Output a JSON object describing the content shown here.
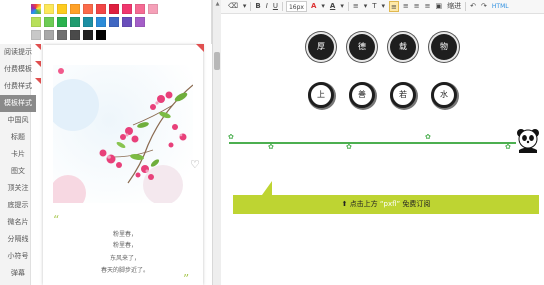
{
  "palette": {
    "rows": [
      [
        "#fde85a",
        "#fecb1f",
        "#ffa127",
        "#fb6b4a",
        "#f24646",
        "#de1f3f",
        "#f0376e",
        "#f56a93",
        "#f5a0b8"
      ],
      [
        "#b8e05a",
        "#6dcc54",
        "#2bb24f",
        "#209c6f",
        "#1c8fa3",
        "#2c8bd8",
        "#3f67c2",
        "#6a4fbb",
        "#a45ec7"
      ],
      [
        "#c8c8c8",
        "#a8a8a8",
        "#707070",
        "#4a4a4a",
        "#222222",
        "#000000"
      ]
    ]
  },
  "sidebar": {
    "items": [
      {
        "label": "阅读提示",
        "active": false,
        "marked": true
      },
      {
        "label": "付费模板",
        "active": false,
        "marked": true
      },
      {
        "label": "付费样式",
        "active": false,
        "marked": true
      },
      {
        "label": "模板样式",
        "active": true,
        "marked": false
      },
      {
        "label": "中国风",
        "active": false,
        "marked": false
      },
      {
        "label": "标题",
        "active": false,
        "marked": false
      },
      {
        "label": "卡片",
        "active": false,
        "marked": false
      },
      {
        "label": "图文",
        "active": false,
        "marked": false
      },
      {
        "label": "顶关注",
        "active": false,
        "marked": false
      },
      {
        "label": "底提示",
        "active": false,
        "marked": false
      },
      {
        "label": "微名片",
        "active": false,
        "marked": false
      },
      {
        "label": "分隔线",
        "active": false,
        "marked": false
      },
      {
        "label": "小符号",
        "active": false,
        "marked": false
      },
      {
        "label": "弹幕",
        "active": false,
        "marked": false
      }
    ]
  },
  "card": {
    "poem": [
      "粉里春，",
      "粉里春，",
      "东风来了，",
      "春天的脚步近了。"
    ],
    "quote_open": "“",
    "quote_close": "”",
    "heart_icon": "heart-icon"
  },
  "toolbar": {
    "font_size": "16px",
    "bold": "B",
    "italic": "I",
    "underline": "U",
    "font_color": "A",
    "bg_color": "A",
    "line_height": "T",
    "indent": "缩进",
    "html": "HTML"
  },
  "editor": {
    "seals_row1": [
      "厚",
      "德",
      "载",
      "物"
    ],
    "seals_row2": [
      "上",
      "善",
      "若",
      "水"
    ],
    "notice": {
      "prefix": "点击上方",
      "highlight": "“pxfl”",
      "suffix": "免费订阅"
    },
    "notice_color": "#bed432",
    "divider_color": "#4caf50"
  }
}
